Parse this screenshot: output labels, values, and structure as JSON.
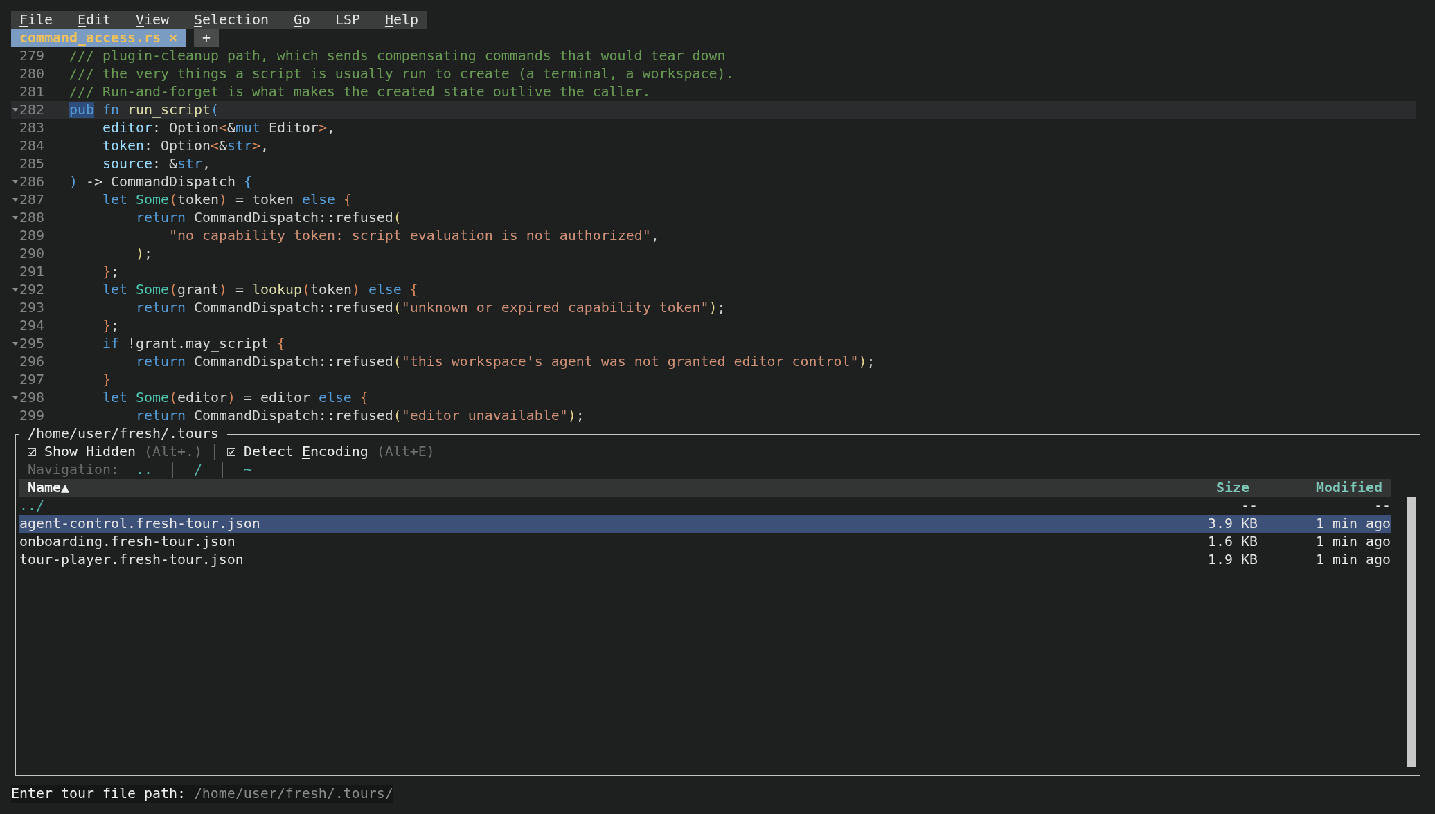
{
  "menu": {
    "items": [
      {
        "label": "File",
        "mnemonic": true
      },
      {
        "label": "Edit",
        "mnemonic": true
      },
      {
        "label": "View",
        "mnemonic": true
      },
      {
        "label": "Selection",
        "mnemonic": true
      },
      {
        "label": "Go",
        "mnemonic": true
      },
      {
        "label": "LSP",
        "mnemonic": false
      },
      {
        "label": "Help",
        "mnemonic": true
      }
    ]
  },
  "tabs": [
    {
      "label": "command_access.rs",
      "close": "×",
      "selected": true
    }
  ],
  "new_tab": {
    "label": "+"
  },
  "editor": {
    "lines": [
      {
        "number": "279",
        "foldable": false,
        "current": false,
        "tokens": [
          {
            "text": "/// plugin-cleanup path, which sends compensating commands that would tear down",
            "kind": "comment"
          }
        ]
      },
      {
        "number": "280",
        "foldable": false,
        "current": false,
        "tokens": [
          {
            "text": "/// the very things a script is usually run to create (a terminal, a workspace).",
            "kind": "comment"
          }
        ]
      },
      {
        "number": "281",
        "foldable": false,
        "current": false,
        "tokens": [
          {
            "text": "/// Run-and-forget is what makes the created state outlive the caller.",
            "kind": "comment"
          }
        ]
      },
      {
        "number": "282",
        "foldable": true,
        "current": true,
        "tokens": [
          {
            "text": "pub",
            "kind": "keyword",
            "highlighted": true
          },
          {
            "text": " fn",
            "kind": "keyword"
          },
          {
            "text": " run_script",
            "kind": "function"
          },
          {
            "text": "(",
            "kind": "bracket_outer"
          }
        ]
      },
      {
        "number": "283",
        "foldable": false,
        "current": false,
        "tokens": [
          {
            "text": "    editor",
            "kind": "field"
          },
          {
            "text": ": Option",
            "kind": "text"
          },
          {
            "text": "<",
            "kind": "bracket_mid"
          },
          {
            "text": "&",
            "kind": "text"
          },
          {
            "text": "mut",
            "kind": "keyword"
          },
          {
            "text": " Editor",
            "kind": "text"
          },
          {
            "text": ">",
            "kind": "bracket_mid"
          },
          {
            "text": ",",
            "kind": "text"
          }
        ]
      },
      {
        "number": "284",
        "foldable": false,
        "current": false,
        "tokens": [
          {
            "text": "    token",
            "kind": "field"
          },
          {
            "text": ": Option",
            "kind": "text"
          },
          {
            "text": "<",
            "kind": "bracket_mid"
          },
          {
            "text": "&",
            "kind": "text"
          },
          {
            "text": "str",
            "kind": "keyword"
          },
          {
            "text": ">",
            "kind": "bracket_mid"
          },
          {
            "text": ",",
            "kind": "text"
          }
        ]
      },
      {
        "number": "285",
        "foldable": false,
        "current": false,
        "tokens": [
          {
            "text": "    source",
            "kind": "field"
          },
          {
            "text": ": &",
            "kind": "text"
          },
          {
            "text": "str",
            "kind": "keyword"
          },
          {
            "text": ",",
            "kind": "text"
          }
        ]
      },
      {
        "number": "286",
        "foldable": true,
        "current": false,
        "tokens": [
          {
            "text": ")",
            "kind": "bracket_outer"
          },
          {
            "text": " -> CommandDispatch ",
            "kind": "text"
          },
          {
            "text": "{",
            "kind": "bracket_outer"
          }
        ]
      },
      {
        "number": "287",
        "foldable": true,
        "current": false,
        "tokens": [
          {
            "text": "    let",
            "kind": "keyword"
          },
          {
            "text": " Some",
            "kind": "type"
          },
          {
            "text": "(",
            "kind": "bracket_mid"
          },
          {
            "text": "token",
            "kind": "text"
          },
          {
            "text": ")",
            "kind": "bracket_mid"
          },
          {
            "text": " = token ",
            "kind": "text"
          },
          {
            "text": "else",
            "kind": "keyword"
          },
          {
            "text": " {",
            "kind": "bracket_mid"
          }
        ]
      },
      {
        "number": "288",
        "foldable": true,
        "current": false,
        "tokens": [
          {
            "text": "        return",
            "kind": "keyword"
          },
          {
            "text": " CommandDispatch::refused",
            "kind": "text"
          },
          {
            "text": "(",
            "kind": "bracket_inner"
          }
        ]
      },
      {
        "number": "289",
        "foldable": false,
        "current": false,
        "tokens": [
          {
            "text": "            \"no capability token: script evaluation is not authorized\"",
            "kind": "string"
          },
          {
            "text": ",",
            "kind": "text"
          }
        ]
      },
      {
        "number": "290",
        "foldable": false,
        "current": false,
        "tokens": [
          {
            "text": "        )",
            "kind": "bracket_inner"
          },
          {
            "text": ";",
            "kind": "text"
          }
        ]
      },
      {
        "number": "291",
        "foldable": false,
        "current": false,
        "tokens": [
          {
            "text": "    }",
            "kind": "bracket_mid"
          },
          {
            "text": ";",
            "kind": "text"
          }
        ]
      },
      {
        "number": "292",
        "foldable": true,
        "current": false,
        "tokens": [
          {
            "text": "    let",
            "kind": "keyword"
          },
          {
            "text": " Some",
            "kind": "type"
          },
          {
            "text": "(",
            "kind": "bracket_mid"
          },
          {
            "text": "grant",
            "kind": "text"
          },
          {
            "text": ")",
            "kind": "bracket_mid"
          },
          {
            "text": " = ",
            "kind": "text"
          },
          {
            "text": "lookup",
            "kind": "function"
          },
          {
            "text": "(",
            "kind": "bracket_mid"
          },
          {
            "text": "token",
            "kind": "text"
          },
          {
            "text": ")",
            "kind": "bracket_mid"
          },
          {
            "text": " else",
            "kind": "keyword"
          },
          {
            "text": " {",
            "kind": "bracket_mid"
          }
        ]
      },
      {
        "number": "293",
        "foldable": false,
        "current": false,
        "tokens": [
          {
            "text": "        return",
            "kind": "keyword"
          },
          {
            "text": " CommandDispatch::refused",
            "kind": "text"
          },
          {
            "text": "(",
            "kind": "bracket_inner"
          },
          {
            "text": "\"unknown or expired capability token\"",
            "kind": "string"
          },
          {
            "text": ")",
            "kind": "bracket_inner"
          },
          {
            "text": ";",
            "kind": "text"
          }
        ]
      },
      {
        "number": "294",
        "foldable": false,
        "current": false,
        "tokens": [
          {
            "text": "    }",
            "kind": "bracket_mid"
          },
          {
            "text": ";",
            "kind": "text"
          }
        ]
      },
      {
        "number": "295",
        "foldable": true,
        "current": false,
        "tokens": [
          {
            "text": "    if",
            "kind": "keyword"
          },
          {
            "text": " !grant.may_script ",
            "kind": "text"
          },
          {
            "text": "{",
            "kind": "bracket_mid"
          }
        ]
      },
      {
        "number": "296",
        "foldable": false,
        "current": false,
        "tokens": [
          {
            "text": "        return",
            "kind": "keyword"
          },
          {
            "text": " CommandDispatch::refused",
            "kind": "text"
          },
          {
            "text": "(",
            "kind": "bracket_inner"
          },
          {
            "text": "\"this workspace's agent was not granted editor control\"",
            "kind": "string"
          },
          {
            "text": ")",
            "kind": "bracket_inner"
          },
          {
            "text": ";",
            "kind": "text"
          }
        ]
      },
      {
        "number": "297",
        "foldable": false,
        "current": false,
        "tokens": [
          {
            "text": "    }",
            "kind": "bracket_mid"
          }
        ]
      },
      {
        "number": "298",
        "foldable": true,
        "current": false,
        "tokens": [
          {
            "text": "    let",
            "kind": "keyword"
          },
          {
            "text": " Some",
            "kind": "type"
          },
          {
            "text": "(",
            "kind": "bracket_mid"
          },
          {
            "text": "editor",
            "kind": "text"
          },
          {
            "text": ")",
            "kind": "bracket_mid"
          },
          {
            "text": " = editor ",
            "kind": "text"
          },
          {
            "text": "else",
            "kind": "keyword"
          },
          {
            "text": " {",
            "kind": "bracket_mid"
          }
        ]
      },
      {
        "number": "299",
        "foldable": false,
        "current": false,
        "tokens": [
          {
            "text": "        return",
            "kind": "keyword"
          },
          {
            "text": " CommandDispatch::refused",
            "kind": "text"
          },
          {
            "text": "(",
            "kind": "bracket_inner"
          },
          {
            "text": "\"editor unavailable\"",
            "kind": "string"
          },
          {
            "text": ")",
            "kind": "bracket_inner"
          },
          {
            "text": ";",
            "kind": "text"
          }
        ]
      }
    ]
  },
  "file_browser": {
    "title": "/home/user/fresh/.tours",
    "toggles": [
      {
        "label_parts": [
          {
            "text": "Show Hidden",
            "underlined": false
          }
        ],
        "shortcut": "(Alt+.)",
        "checked": true
      },
      {
        "label_parts": [
          {
            "text": "Detect ",
            "underlined": false
          },
          {
            "text": "E",
            "underlined": true
          },
          {
            "text": "ncoding",
            "underlined": false
          }
        ],
        "shortcut": "(Alt+E)",
        "checked": true
      }
    ],
    "navigation": {
      "label": "Navigation:",
      "links": [
        "..",
        "/",
        "~"
      ]
    },
    "columns": [
      {
        "label": "Name▲",
        "kind": "name",
        "sorted": true
      },
      {
        "label": "Size",
        "kind": "size",
        "sorted": false
      },
      {
        "label": "Modified",
        "kind": "date",
        "sorted": false
      }
    ],
    "rows": [
      {
        "name": "../",
        "size": "--",
        "modified": "--",
        "kind": "folder",
        "selected": false
      },
      {
        "name": "agent-control.fresh-tour.json",
        "size": "3.9 KB",
        "modified": "1 min ago",
        "kind": "file",
        "selected": true
      },
      {
        "name": "onboarding.fresh-tour.json",
        "size": "1.6 KB",
        "modified": "1 min ago",
        "kind": "file",
        "selected": false
      },
      {
        "name": "tour-player.fresh-tour.json",
        "size": "1.9 KB",
        "modified": "1 min ago",
        "kind": "file",
        "selected": false
      }
    ]
  },
  "prompt": {
    "label": "Enter tour file path:",
    "value": "/home/user/fresh/.tours/"
  }
}
